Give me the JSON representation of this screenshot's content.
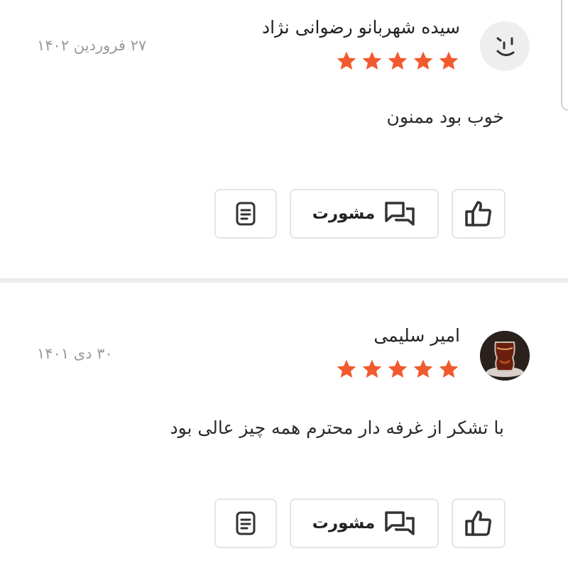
{
  "colors": {
    "star": "#f15a2e",
    "text": "#222222",
    "muted": "#9a9a9a",
    "border": "#e4e4e4",
    "divider": "#ececec"
  },
  "reviews": [
    {
      "name": "سیده شهربانو رضوانی نژاد",
      "date": "۲۷ فروردین ۱۴۰۲",
      "rating": 5,
      "text": "خوب بود ممنون",
      "avatar_icon": "face-avatar-icon",
      "actions": {
        "consult_label": "مشورت",
        "consult_icon": "chat-bubbles-icon",
        "like_icon": "thumbs-up-icon",
        "report_icon": "document-icon"
      }
    },
    {
      "name": "امیر سلیمی",
      "date": "۳۰ دی ۱۴۰۱",
      "rating": 5,
      "text": "با تشکر از غرفه دار محترم همه چیز عالی بود",
      "avatar_icon": "tea-glass-avatar",
      "actions": {
        "consult_label": "مشورت",
        "consult_icon": "chat-bubbles-icon",
        "like_icon": "thumbs-up-icon",
        "report_icon": "document-icon"
      }
    }
  ]
}
